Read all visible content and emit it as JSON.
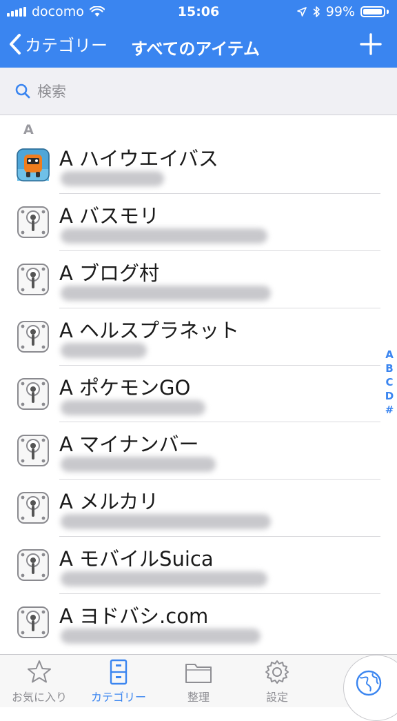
{
  "status_bar": {
    "carrier": "docomo",
    "time": "15:06",
    "battery": "99%"
  },
  "nav": {
    "back_label": "カテゴリー",
    "title": "すべてのアイテム"
  },
  "search": {
    "placeholder": "検索"
  },
  "section": {
    "header": "A"
  },
  "items": [
    {
      "title": "A ハイウエイバス",
      "icon": "bus-app-icon"
    },
    {
      "title": "A バスモリ",
      "icon": "keyhole-lock-icon"
    },
    {
      "title": "A ブログ村",
      "icon": "keyhole-lock-icon"
    },
    {
      "title": "A ヘルスプラネット",
      "icon": "keyhole-lock-icon"
    },
    {
      "title": "A ポケモンGO",
      "icon": "keyhole-lock-icon"
    },
    {
      "title": "A マイナンバー",
      "icon": "keyhole-lock-icon"
    },
    {
      "title": "A メルカリ",
      "icon": "keyhole-lock-icon"
    },
    {
      "title": "A モバイルSuica",
      "icon": "keyhole-lock-icon"
    },
    {
      "title": "A ヨドバシ.com",
      "icon": "keyhole-lock-icon"
    }
  ],
  "index_letters": [
    "A",
    "B",
    "C",
    "D",
    "#"
  ],
  "tabs": [
    {
      "label": "お気に入り",
      "icon": "star-icon"
    },
    {
      "label": "カテゴリー",
      "icon": "cabinet-icon",
      "active": true
    },
    {
      "label": "整理",
      "icon": "folder-icon"
    },
    {
      "label": "設定",
      "icon": "gear-icon"
    }
  ],
  "colors": {
    "accent": "#3a85f0",
    "tab_inactive": "#8e8e93"
  }
}
